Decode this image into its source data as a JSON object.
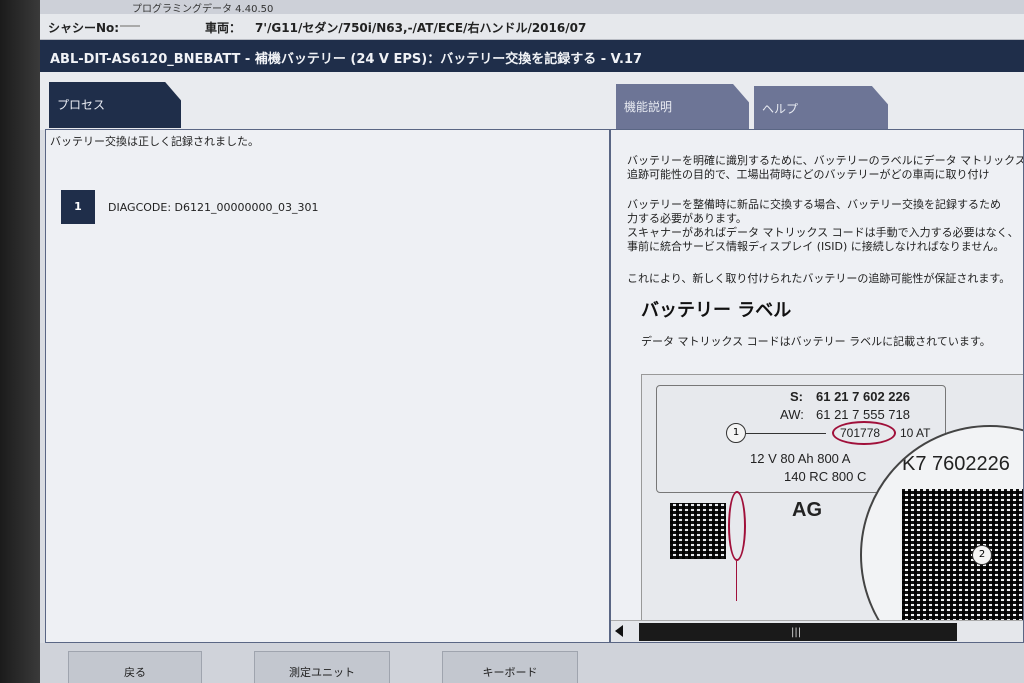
{
  "header": {
    "app_version_label": "プログラミングデータ 4.40.50",
    "chassis_label": "シャシーNo:",
    "vehicle_label": "車両：",
    "vehicle_value": "7'/G11/セダン/750i/N63,-/AT/ECE/右ハンドル/2016/07"
  },
  "title": "ABL-DIT-AS6120_BNEBATT - 補機バッテリー (24 V EPS)：バッテリー交換を記録する - V.17",
  "tabs": {
    "process": "プロセス",
    "function_description": "機能説明",
    "help": "ヘルプ"
  },
  "left_panel": {
    "status_text": "バッテリー交換は正しく記録されました。",
    "steps": [
      {
        "number": "1",
        "text": "DIAGCODE: D6121_00000000_03_301"
      }
    ]
  },
  "help_panel": {
    "para1_line1": "バッテリーを明確に識別するために、バッテリーのラベルにデータ マトリックス",
    "para1_line2": "追跡可能性の目的で、工場出荷時にどのバッテリーがどの車両に取り付け",
    "para2_line1": "バッテリーを整備時に新品に交換する場合、バッテリー交換を記録するため",
    "para2_line2": "力する必要があります。",
    "para2_line3": "スキャナーがあればデータ マトリックス コードは手動で入力する必要はなく、",
    "para2_line4": "事前に統合サービス情報ディスプレイ (ISID) に接続しなければなりません。",
    "para3": "これにより、新しく取り付けられたバッテリーの追跡可能性が保証されます。",
    "heading": "バッテリー ラベル",
    "subtext": "データ マトリックス コードはバッテリー ラベルに記載されています。",
    "label_image": {
      "s_prefix": "S:",
      "s_number": "61 21 7 602 226",
      "aw_prefix": "AW:",
      "aw_number": "61 21 7 555 718",
      "serial": "701778",
      "serial_suffix": "10 AT",
      "spec_line1": "12 V  80 Ah    800 A",
      "spec_line2": "140 RC 800 C",
      "zoom_code": "K7 7602226",
      "marker1": "1",
      "marker2": "2",
      "partial_text": "AG"
    }
  },
  "buttons": {
    "back": "戻る",
    "measurement_unit": "測定ユニット",
    "keyboard": "キーボード"
  },
  "colors": {
    "title_bar": "#1f2e4a",
    "tab_inactive": "#6d7596",
    "highlight_oval": "#a0103a"
  }
}
